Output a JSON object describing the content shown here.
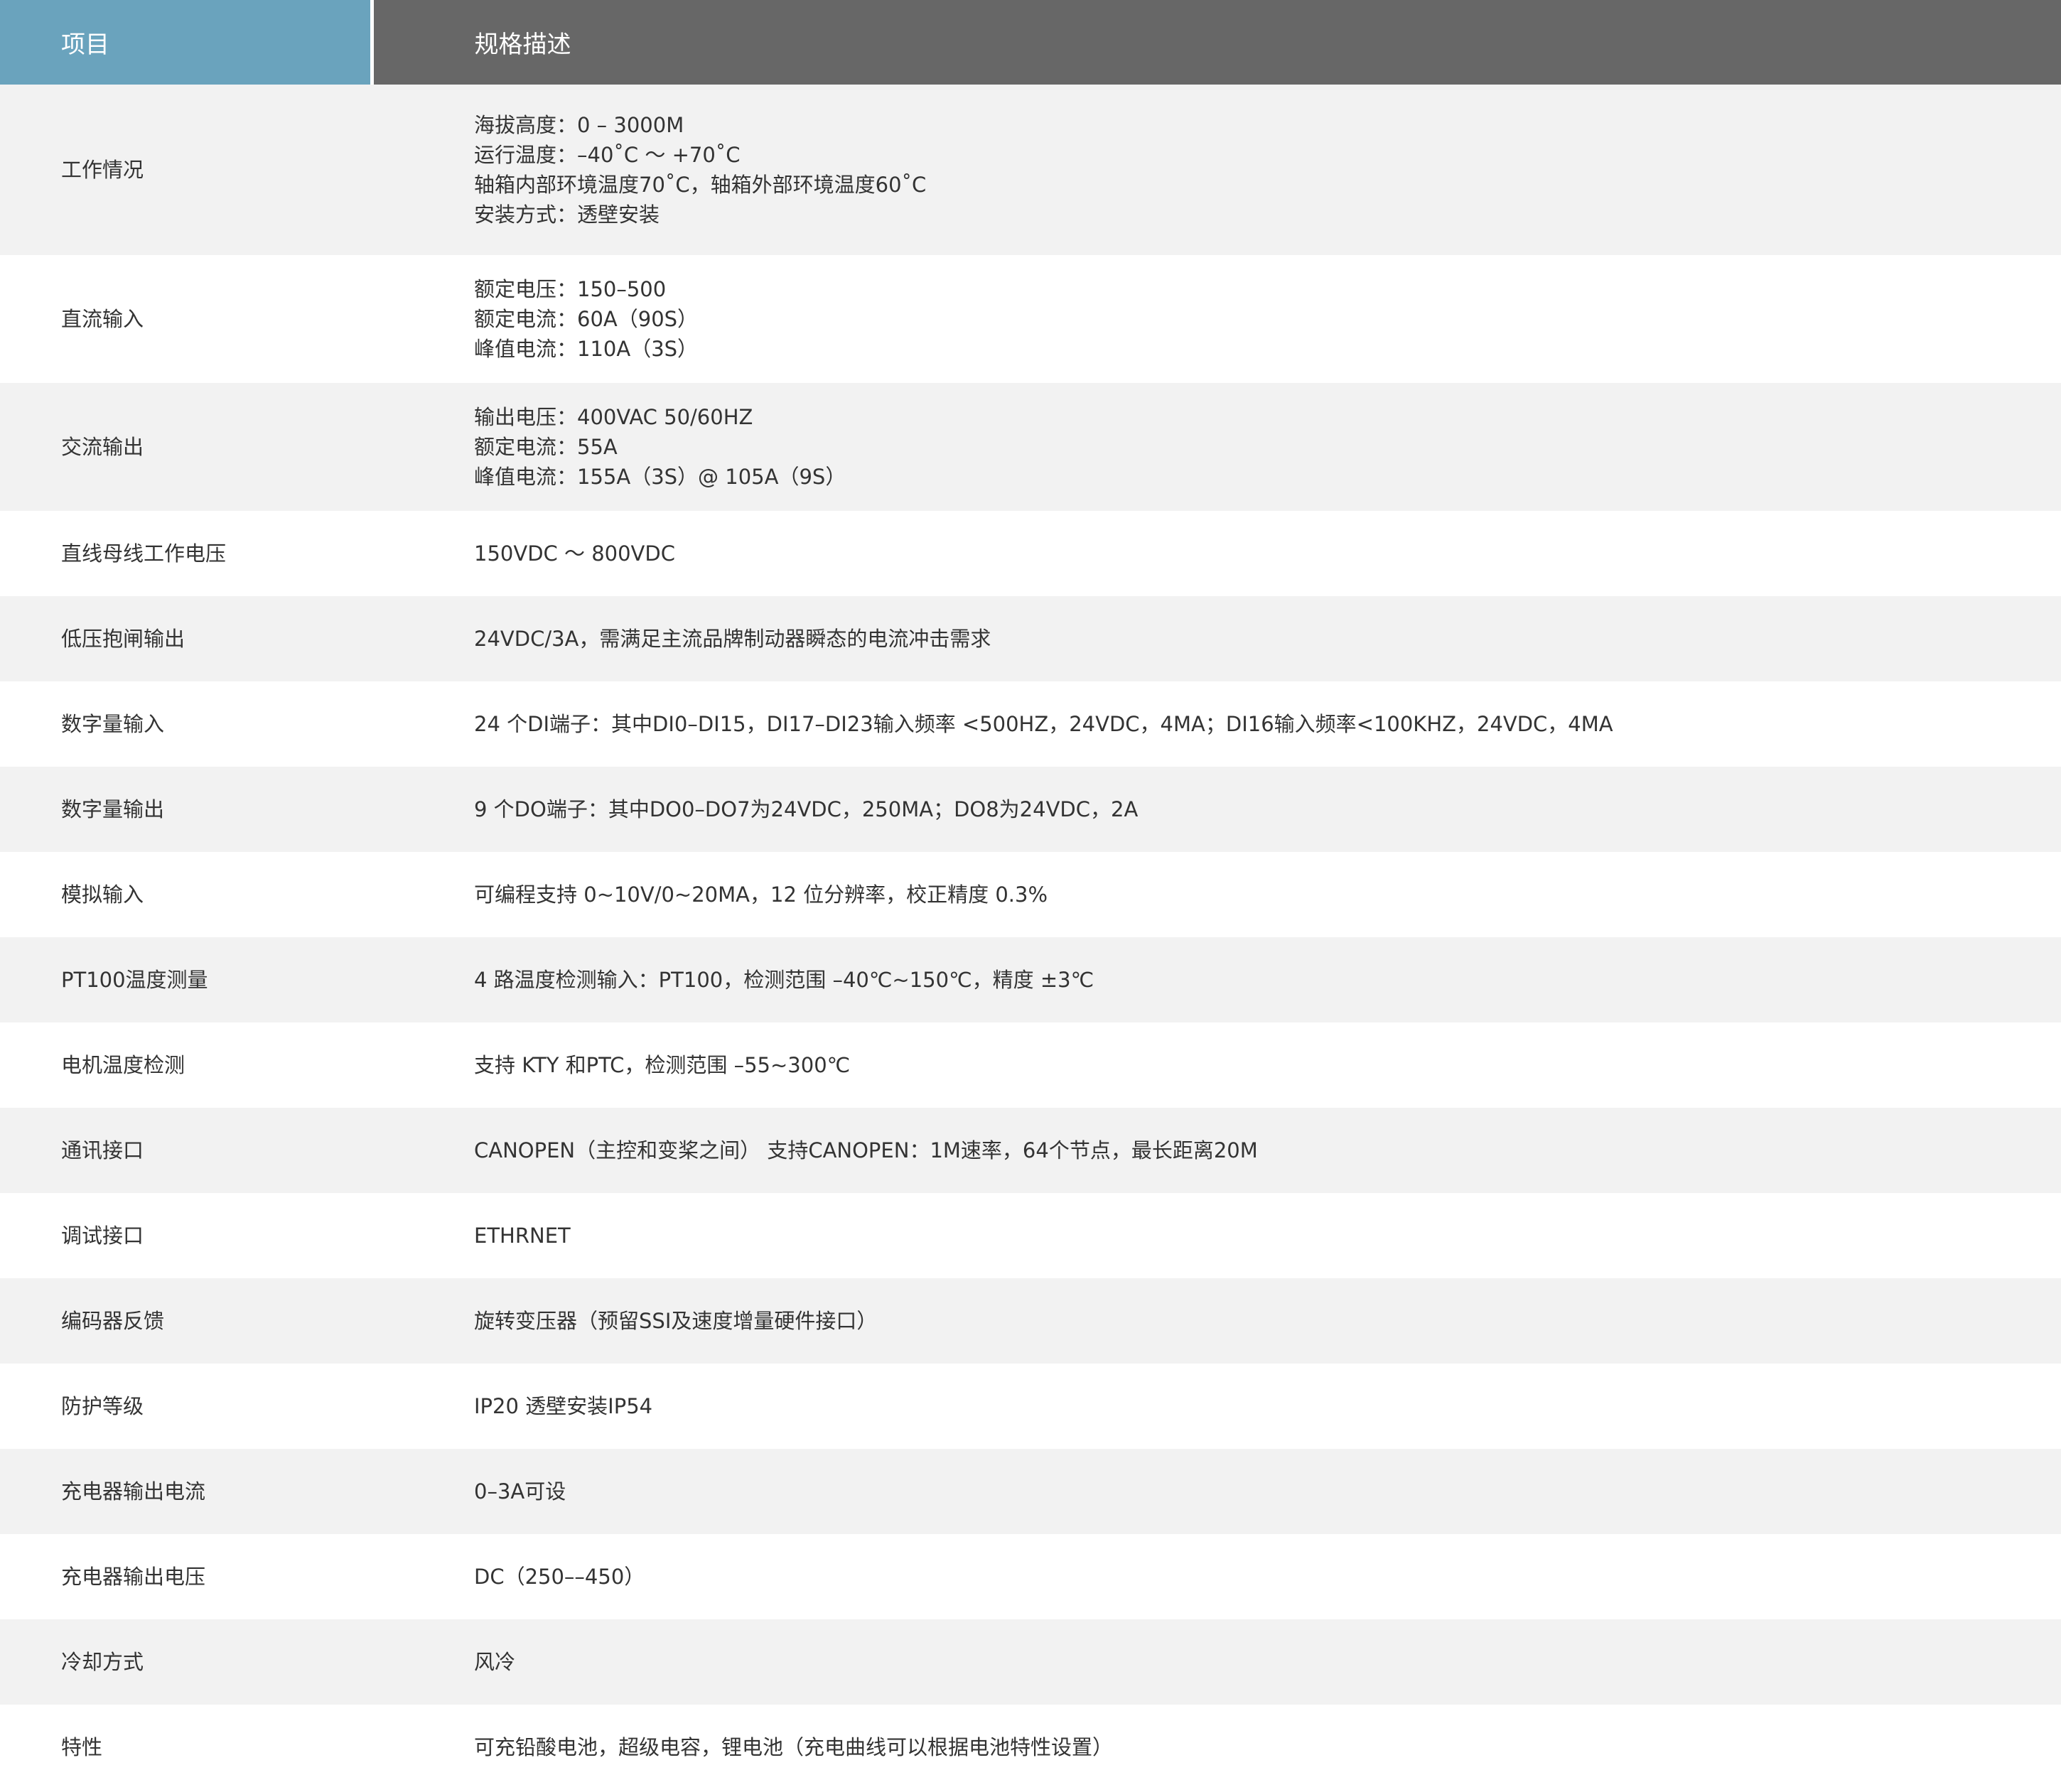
{
  "header": {
    "item_label": "项目",
    "desc_label": "规格描述"
  },
  "rows": [
    {
      "item": "工作情况",
      "lines": [
        "海拔高度：0 – 3000M",
        "运行温度：–40˚C ～ +70˚C",
        "轴箱内部环境温度70˚C，轴箱外部环境温度60˚C",
        "安装方式：透壁安装"
      ]
    },
    {
      "item": "直流输入",
      "lines": [
        "额定电压：150–500",
        "额定电流：60A（90S）",
        "峰值电流：110A（3S）"
      ]
    },
    {
      "item": "交流输出",
      "lines": [
        "输出电压：400VAC 50/60HZ",
        "额定电流：55A",
        "峰值电流：155A（3S）@ 105A（9S）"
      ]
    },
    {
      "item": "直线母线工作电压",
      "lines": [
        "150VDC ～ 800VDC"
      ]
    },
    {
      "item": "低压抱闸输出",
      "lines": [
        "24VDC/3A，需满足主流品牌制动器瞬态的电流冲击需求"
      ]
    },
    {
      "item": "数字量输入",
      "lines": [
        "24 个DI端子：其中DI0–DI15，DI17–DI23输入频率 <500HZ，24VDC，4MA；DI16输入频率<100KHZ，24VDC，4MA"
      ]
    },
    {
      "item": "数字量输出",
      "lines": [
        "9 个DO端子：其中DO0–DO7为24VDC，250MA；DO8为24VDC，2A"
      ]
    },
    {
      "item": "模拟输入",
      "lines": [
        "可编程支持 0~10V/0~20MA，12 位分辨率，校正精度 0.3%"
      ]
    },
    {
      "item": "PT100温度测量",
      "lines": [
        "4 路温度检测输入：PT100，检测范围 –40℃~150℃，精度 ±3℃"
      ]
    },
    {
      "item": "电机温度检测",
      "lines": [
        "支持 KTY 和PTC，检测范围 –55~300℃"
      ]
    },
    {
      "item": "通讯接口",
      "lines": [
        "CANOPEN（主控和变桨之间） 支持CANOPEN：1M速率，64个节点，最长距离20M"
      ]
    },
    {
      "item": "调试接口",
      "lines": [
        "ETHRNET"
      ]
    },
    {
      "item": "编码器反馈",
      "lines": [
        "旋转变压器（预留SSI及速度增量硬件接口）"
      ]
    },
    {
      "item": "防护等级",
      "lines": [
        "IP20 透壁安装IP54"
      ]
    },
    {
      "item": "充电器输出电流",
      "lines": [
        "0–3A可设"
      ]
    },
    {
      "item": "充电器输出电压",
      "lines": [
        "DC（250––450）"
      ]
    },
    {
      "item": "冷却方式",
      "lines": [
        "风冷"
      ]
    },
    {
      "item": "特性",
      "lines": [
        "可充铅酸电池，超级电容，锂电池（充电曲线可以根据电池特性设置）"
      ]
    }
  ],
  "colors": {
    "header_item_bg": "#6aa3bd",
    "header_desc_bg": "#676767",
    "row_alt_bg": "#f2f2f2",
    "text": "#333333"
  }
}
